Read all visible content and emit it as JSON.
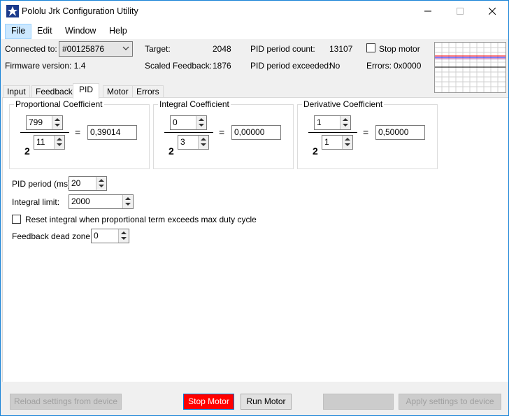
{
  "window": {
    "title": "Pololu Jrk Configuration Utility"
  },
  "menu": {
    "items": [
      "File",
      "Edit",
      "Window",
      "Help"
    ]
  },
  "status": {
    "connected_label": "Connected to:",
    "device": "#00125876",
    "firmware_label": "Firmware version: 1.4",
    "target_label": "Target:",
    "target_value": "2048",
    "scaled_label": "Scaled Feedback:",
    "scaled_value": "1876",
    "pid_count_label": "PID period count:",
    "pid_count_value": "13107",
    "pid_exceeded_label": "PID period exceeded:",
    "pid_exceeded_value": "No",
    "stop_motor_label": "Stop motor",
    "errors_label": "Errors:",
    "errors_value": "0x0000"
  },
  "tabs": [
    "Input",
    "Feedback",
    "PID",
    "Motor",
    "Errors"
  ],
  "selected_tab": "PID",
  "pid": {
    "proportional": {
      "title": "Proportional Coefficient",
      "multiplier": "799",
      "exponent": "11",
      "base": "2",
      "equals": "=",
      "result": "0,39014"
    },
    "integral": {
      "title": "Integral Coefficient",
      "multiplier": "0",
      "exponent": "3",
      "base": "2",
      "equals": "=",
      "result": "0,00000"
    },
    "derivative": {
      "title": "Derivative Coefficient",
      "multiplier": "1",
      "exponent": "1",
      "base": "2",
      "equals": "=",
      "result": "0,50000"
    },
    "period_label": "PID period (ms):",
    "period_value": "20",
    "integral_limit_label": "Integral limit:",
    "integral_limit_value": "2000",
    "reset_integral_label": "Reset integral when proportional term exceeds max duty cycle",
    "deadzone_label": "Feedback dead zone:",
    "deadzone_value": "0"
  },
  "buttons": {
    "reload": "Reload settings from device",
    "stop": "Stop Motor",
    "run": "Run Motor",
    "blank": "",
    "apply": "Apply settings to device"
  },
  "colors": {
    "accent": "#1883d7",
    "stop_button": "#ff0000",
    "menu_active": "#cce8ff"
  }
}
